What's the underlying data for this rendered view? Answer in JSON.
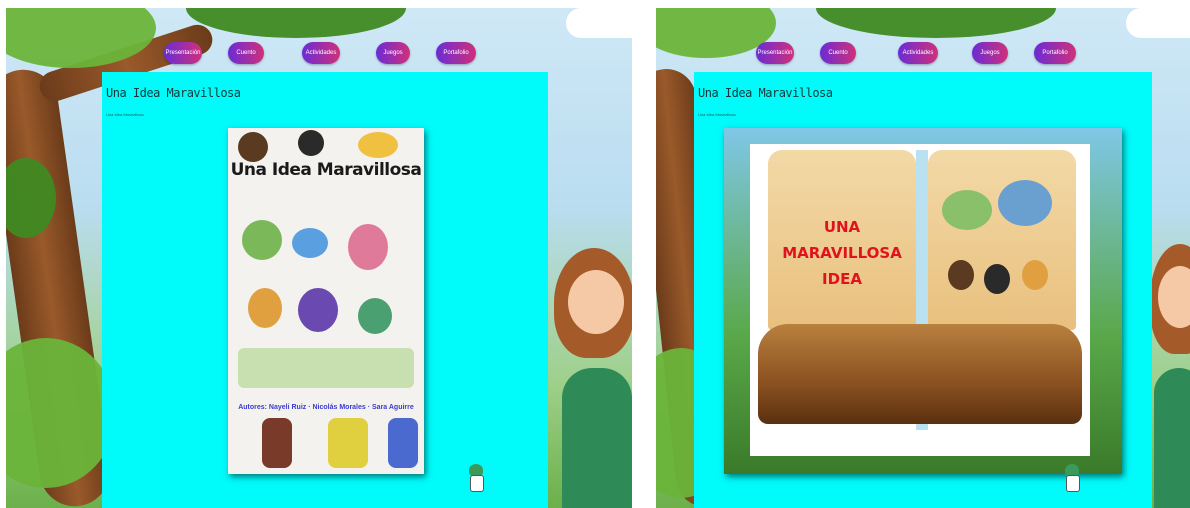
{
  "nav": {
    "items": [
      "Presentación",
      "Cuento",
      "Actividades",
      "Juegos",
      "Portafolio"
    ]
  },
  "left": {
    "page_title": "Una Idea Maravillosa",
    "page_subtitle": "Una Idea Maravillosa",
    "cover_title": "Una Idea Maravillosa",
    "cover_authors": "Autores: Nayeli Ruiz · Nicolás Morales · Sara Aguirre"
  },
  "right": {
    "page_title": "Una Idea Maravillosa",
    "page_subtitle": "Una Idea Maravillosa",
    "book_title_lines": [
      "UNA",
      "MARAVILLOSA",
      "IDEA"
    ]
  },
  "colors": {
    "content_bg": "#00fbfb",
    "nav_gradient": [
      "#6a2cd6",
      "#d0307a"
    ],
    "book_title": "#e0121e"
  },
  "icons": [
    "mascot-icon"
  ]
}
